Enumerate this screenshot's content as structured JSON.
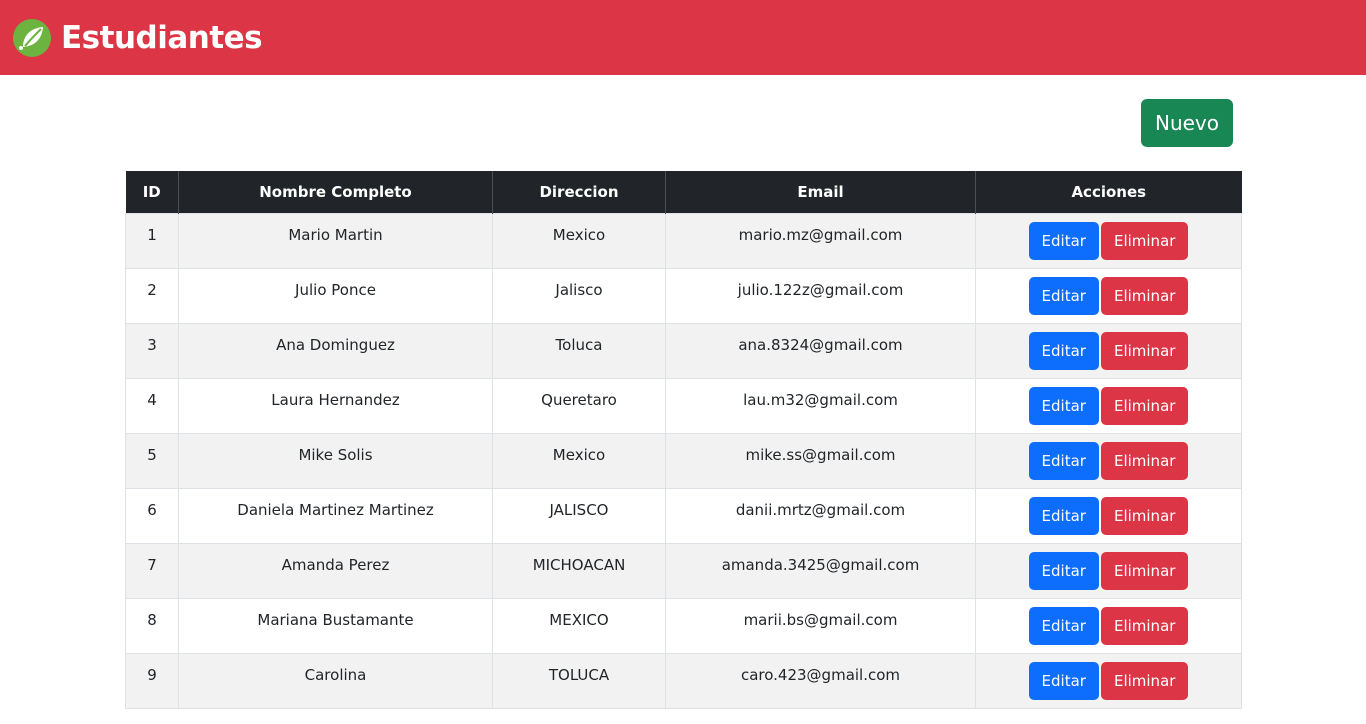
{
  "navbar": {
    "title": "Estudiantes",
    "logo_icon": "spring-leaf-icon",
    "background": "#dc3545"
  },
  "new_button": {
    "label": "Nuevo",
    "color": "#198754"
  },
  "table": {
    "headers": [
      "ID",
      "Nombre Completo",
      "Direccion",
      "Email",
      "Acciones"
    ],
    "rows": [
      {
        "id": "1",
        "name": "Mario Martin",
        "address": "Mexico",
        "email": "mario.mz@gmail.com"
      },
      {
        "id": "2",
        "name": "Julio Ponce",
        "address": "Jalisco",
        "email": "julio.122z@gmail.com"
      },
      {
        "id": "3",
        "name": "Ana Dominguez",
        "address": "Toluca",
        "email": "ana.8324@gmail.com"
      },
      {
        "id": "4",
        "name": "Laura Hernandez",
        "address": "Queretaro",
        "email": "lau.m32@gmail.com"
      },
      {
        "id": "5",
        "name": "Mike Solis",
        "address": "Mexico",
        "email": "mike.ss@gmail.com"
      },
      {
        "id": "6",
        "name": "Daniela Martinez Martinez",
        "address": "JALISCO",
        "email": "danii.mrtz@gmail.com"
      },
      {
        "id": "7",
        "name": "Amanda Perez",
        "address": "MICHOACAN",
        "email": "amanda.3425@gmail.com"
      },
      {
        "id": "8",
        "name": "Mariana Bustamante",
        "address": "MEXICO",
        "email": "marii.bs@gmail.com"
      },
      {
        "id": "9",
        "name": "Carolina",
        "address": "TOLUCA",
        "email": "caro.423@gmail.com"
      }
    ],
    "actions": {
      "edit_label": "Editar",
      "delete_label": "Eliminar"
    }
  },
  "colors": {
    "edit": "#0d6efd",
    "delete": "#dc3545",
    "header_bg": "#212529"
  }
}
